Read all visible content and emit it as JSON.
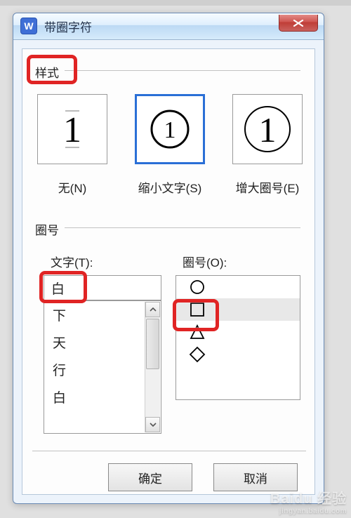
{
  "titlebar": {
    "app_glyph": "W",
    "title": "带圈字符"
  },
  "section": {
    "style_label": "样式",
    "enclosure_label": "圈号"
  },
  "styles": {
    "options": [
      {
        "key": "none",
        "label": "无(N)"
      },
      {
        "key": "shrink",
        "label": "缩小文字(S)"
      },
      {
        "key": "enlarge",
        "label": "增大圈号(E)"
      }
    ],
    "selected": "shrink"
  },
  "text_field": {
    "label": "文字(T):",
    "value": "白",
    "list": [
      "下",
      "天",
      "行",
      "白"
    ]
  },
  "shape_field": {
    "label": "圈号(O):",
    "options": [
      "circle",
      "square",
      "triangle",
      "diamond"
    ],
    "selected": "square"
  },
  "buttons": {
    "ok": "确定",
    "cancel": "取消"
  },
  "watermark": {
    "brand": "Baidu 经验",
    "url": "jingyan.baidu.com"
  }
}
